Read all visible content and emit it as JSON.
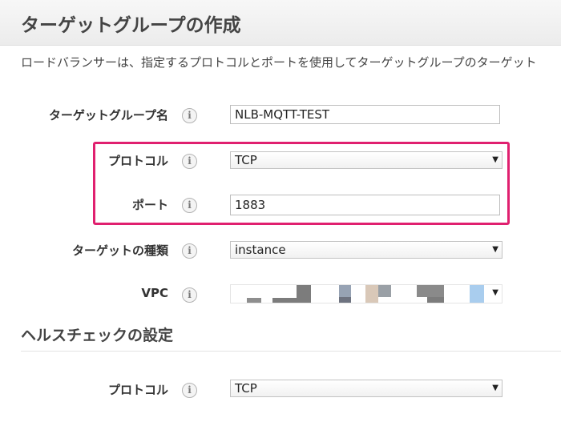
{
  "header": {
    "title": "ターゲットグループの作成"
  },
  "description": "ロードバランサーは、指定するプロトコルとポートを使用してターゲットグループのターゲット",
  "form": {
    "target_group_name": {
      "label": "ターゲットグループ名",
      "value": "NLB-MQTT-TEST",
      "info_icon": "i"
    },
    "protocol": {
      "label": "プロトコル",
      "value": "TCP",
      "info_icon": "i"
    },
    "port": {
      "label": "ポート",
      "value": "1883",
      "info_icon": "i"
    },
    "target_type": {
      "label": "ターゲットの種類",
      "value": "instance",
      "info_icon": "i"
    },
    "vpc": {
      "label": "VPC",
      "info_icon": "i"
    }
  },
  "health_check": {
    "title": "ヘルスチェックの設定",
    "protocol": {
      "label": "プロトコル",
      "value": "TCP",
      "info_icon": "i"
    }
  },
  "ui": {
    "dropdown_arrow": "▼",
    "highlight_color": "#e0206f"
  }
}
